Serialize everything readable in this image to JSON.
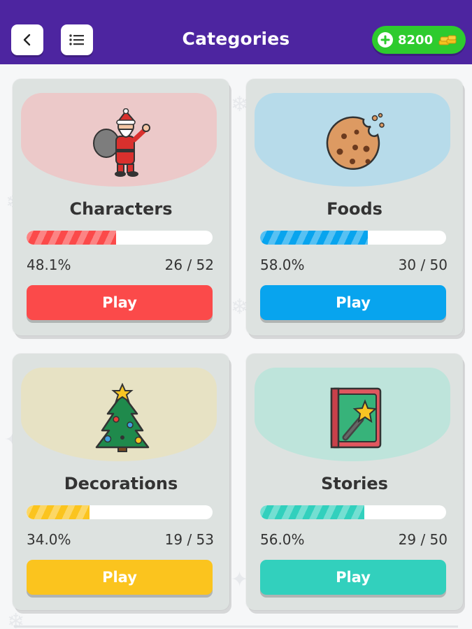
{
  "header": {
    "title": "Categories",
    "back_icon": "chevron-left-icon",
    "menu_icon": "list-icon",
    "coins": "8200",
    "coins_icon": "gold-coins-icon",
    "colors": {
      "bar": "#4d25a0",
      "coins": "#2ecb2e"
    }
  },
  "categories": [
    {
      "title": "Characters",
      "percent": "48.1%",
      "progress": 0.481,
      "count": "26 / 52",
      "play_label": "Play",
      "icon": "santa-icon",
      "bg_color": "#ecc9c9",
      "accent_color": "#fb4a4a"
    },
    {
      "title": "Foods",
      "percent": "58.0%",
      "progress": 0.58,
      "count": "30 / 50",
      "play_label": "Play",
      "icon": "cookie-icon",
      "bg_color": "#b7dbea",
      "accent_color": "#08a4ee"
    },
    {
      "title": "Decorations",
      "percent": "34.0%",
      "progress": 0.34,
      "count": "19 / 53",
      "play_label": "Play",
      "icon": "christmas-tree-icon",
      "bg_color": "#e7e2c4",
      "accent_color": "#fbc41e"
    },
    {
      "title": "Stories",
      "percent": "56.0%",
      "progress": 0.56,
      "count": "29 / 50",
      "play_label": "Play",
      "icon": "magic-book-icon",
      "bg_color": "#bee4db",
      "accent_color": "#32d0bd"
    }
  ]
}
